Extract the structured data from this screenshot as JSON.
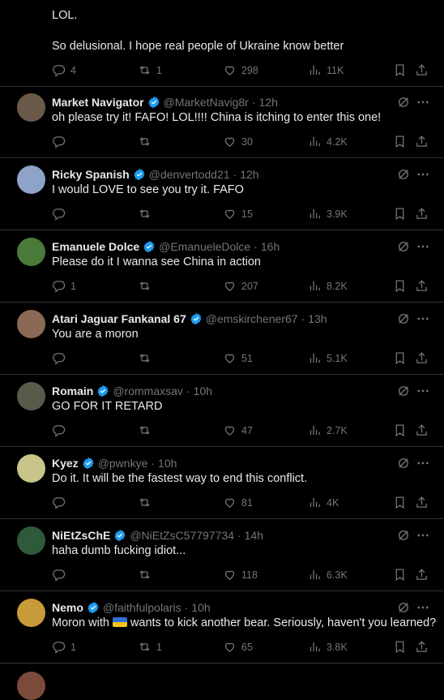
{
  "top_post": {
    "line1": "LOL.",
    "line2": "So delusional. I hope real people of Ukraine know better",
    "replies": "4",
    "reposts": "1",
    "likes": "298",
    "views": "11K"
  },
  "replies": [
    {
      "name": "Market Navigator",
      "handle": "@MarketNavig8r",
      "time": "12h",
      "text": "oh please try it!  FAFO! LOL!!!!  China is itching to enter this one!",
      "replies": "",
      "reposts": "",
      "likes": "30",
      "views": "4.2K",
      "avatar_color": "#6b5a4a"
    },
    {
      "name": "Ricky Spanish",
      "handle": "@denvertodd21",
      "time": "12h",
      "text": "I would LOVE to see you try it. FAFO",
      "replies": "",
      "reposts": "",
      "likes": "15",
      "views": "3.9K",
      "avatar_color": "#8fa3c8"
    },
    {
      "name": "Emanuele Dolce",
      "handle": "@EmanueleDolce",
      "time": "16h",
      "text": "Please do it I wanna see China in action",
      "replies": "1",
      "reposts": "",
      "likes": "207",
      "views": "8.2K",
      "avatar_color": "#4a7a3a"
    },
    {
      "name": "Atari Jaguar Fankanal 67",
      "handle": "@emskirchener67",
      "time": "13h",
      "text": "You are a moron",
      "replies": "",
      "reposts": "",
      "likes": "51",
      "views": "5.1K",
      "avatar_color": "#8a6a55"
    },
    {
      "name": "Romain",
      "handle": "@rommaxsav",
      "time": "10h",
      "text": "GO FOR IT RETARD",
      "replies": "",
      "reposts": "",
      "likes": "47",
      "views": "2.7K",
      "avatar_color": "#5a5a4a"
    },
    {
      "name": "Kyez",
      "handle": "@pwnkye",
      "time": "10h",
      "text": "Do it. It will be the fastest way to end this conflict.",
      "replies": "",
      "reposts": "",
      "likes": "81",
      "views": "4K",
      "avatar_color": "#c9c48a"
    },
    {
      "name": "NiEtZsChE",
      "handle": "@NiEtZsC57797734",
      "time": "14h",
      "text": "haha dumb fucking idiot...",
      "replies": "",
      "reposts": "",
      "likes": "118",
      "views": "6.3K",
      "avatar_color": "#2e5a3a"
    },
    {
      "name": "Nemo",
      "handle": "@faithfulpolaris",
      "time": "10h",
      "text": "Moron with",
      "text_after": "wants to kick another bear. Seriously, haven't you learned?",
      "replies": "1",
      "reposts": "1",
      "likes": "65",
      "views": "3.8K",
      "avatar_color": "#c79a3a"
    }
  ],
  "colors": {
    "background": "#000000",
    "text": "#e7e9ea",
    "muted": "#71767b",
    "divider": "#2f3336",
    "verified": "#1d9bf0"
  },
  "icons": [
    "reply-icon",
    "repost-icon",
    "like-icon",
    "views-icon",
    "bookmark-icon",
    "share-icon",
    "grok-icon",
    "more-icon",
    "verified-badge-icon",
    "ukraine-flag-emoji"
  ]
}
